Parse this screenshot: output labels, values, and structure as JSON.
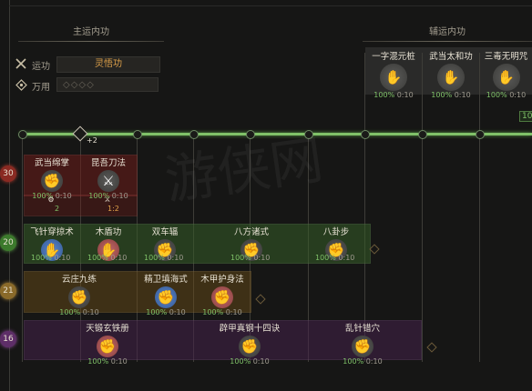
{
  "main_panel": {
    "title": "主运内功",
    "rows": [
      {
        "label": "运功",
        "icon": "crossed-swords-icon",
        "value": "灵悟功"
      },
      {
        "label": "万用",
        "icon": "compass-icon",
        "value": "◇◇◇◇"
      }
    ]
  },
  "aux_panel": {
    "title": "辅运内功",
    "skills": [
      {
        "name": "一字混元桩",
        "pct": "100%",
        "lv": "0:10"
      },
      {
        "name": "武当太和功",
        "pct": "100%",
        "lv": "0:10"
      },
      {
        "name": "三毒无明咒",
        "pct": "100%",
        "lv": "0:10"
      }
    ],
    "edge_value": "10"
  },
  "track": {
    "plus_label": "+2"
  },
  "tiers": [
    {
      "value": "30",
      "color": "#8a2a22"
    },
    {
      "value": "20",
      "color": "#3c7a2c"
    },
    {
      "value": "21",
      "color": "#8a6a2a"
    },
    {
      "value": "16",
      "color": "#5e2e68"
    }
  ],
  "skills": {
    "wudang_mianzhang": {
      "name": "武当绵掌",
      "pct": "100%",
      "lv": "0:10",
      "icon": "palm-strike-icon",
      "sub_icon": "gear-icon",
      "sub_value": "2"
    },
    "kunwu_daofa": {
      "name": "昆吾刀法",
      "pct": "100%",
      "lv": "0:10",
      "icon": "saber-icon",
      "sub_icon": "swords-icon",
      "sub_value": "1:2"
    },
    "feizhen": {
      "name": "飞针穿掠术",
      "pct": "100%",
      "lv": "0:10",
      "icon": "needle-hand-icon"
    },
    "muying": {
      "name": "木盾功",
      "pct": "100%",
      "lv": "0:10",
      "icon": "shield-hand-icon"
    },
    "shuangche": {
      "name": "双车辐",
      "pct": "100%",
      "lv": "0:10",
      "icon": "martial-pose-icon"
    },
    "bafang": {
      "name": "八方诸式",
      "pct": "100%",
      "lv": "0:10",
      "icon": "martial-pose-icon"
    },
    "bagua": {
      "name": "八卦步",
      "pct": "100%",
      "lv": "0:10",
      "icon": "stance-icon"
    },
    "yunzhuang": {
      "name": "云庄九练",
      "pct": "100%",
      "lv": "0:10",
      "icon": "martial-pose-icon"
    },
    "jingwei": {
      "name": "精卫填海式",
      "pct": "100%",
      "lv": "0:10",
      "icon": "fist-blue-icon"
    },
    "mujia": {
      "name": "木甲护身法",
      "pct": "100%",
      "lv": "0:10",
      "icon": "guard-red-icon"
    },
    "tianluo": {
      "name": "天锻玄铁册",
      "pct": "100%",
      "lv": "0:10",
      "icon": "martial-red-icon"
    },
    "bijia": {
      "name": "辟甲真钢十四诀",
      "pct": "100%",
      "lv": "0:10",
      "icon": "martial-pose-icon"
    },
    "luanzhen": {
      "name": "乱针错穴",
      "pct": "100%",
      "lv": "0:10",
      "icon": "martial-pose-icon"
    }
  }
}
